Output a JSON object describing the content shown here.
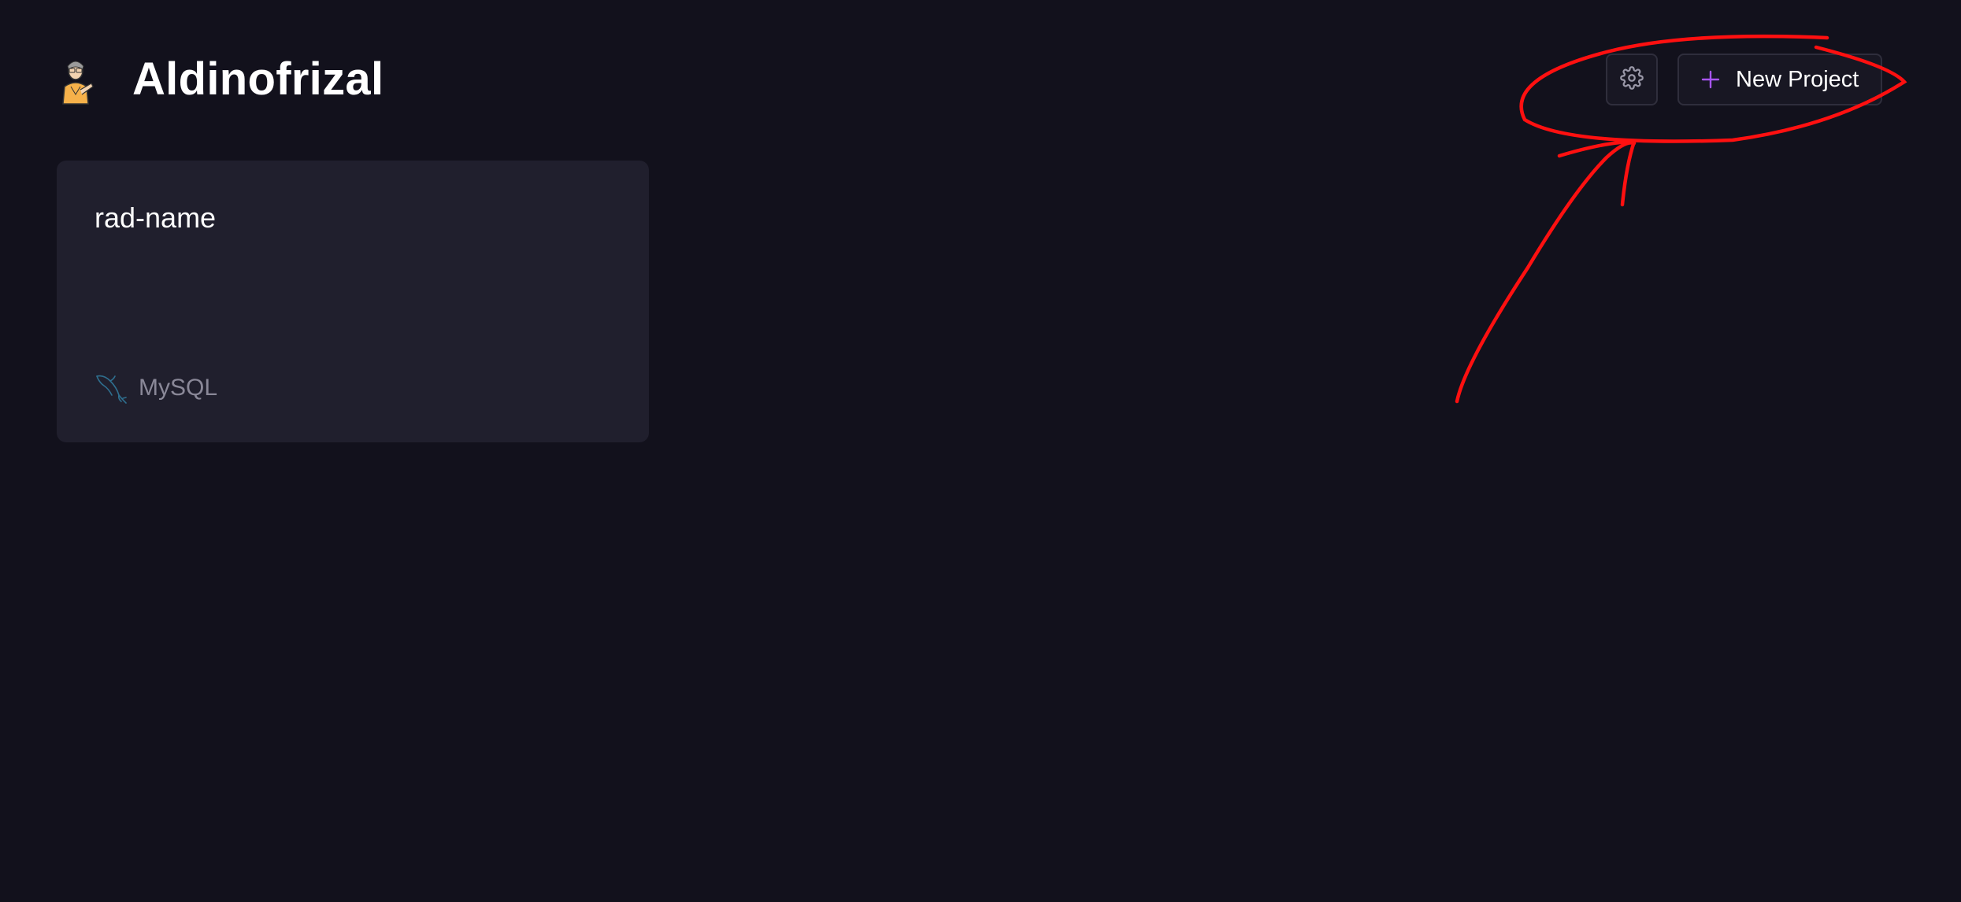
{
  "header": {
    "org_name": "Aldinofrizal",
    "avatar_icon": "person-avatar-icon",
    "settings_icon": "gear-icon",
    "new_project_icon": "plus-icon",
    "new_project_label": "New Project"
  },
  "projects": [
    {
      "name": "rad-name",
      "database": "MySQL",
      "database_icon": "mysql-dolphin-icon"
    }
  ],
  "colors": {
    "background": "#12111c",
    "card": "#201f2d",
    "accent": "#a855f7",
    "annotation": "#ff1010"
  }
}
